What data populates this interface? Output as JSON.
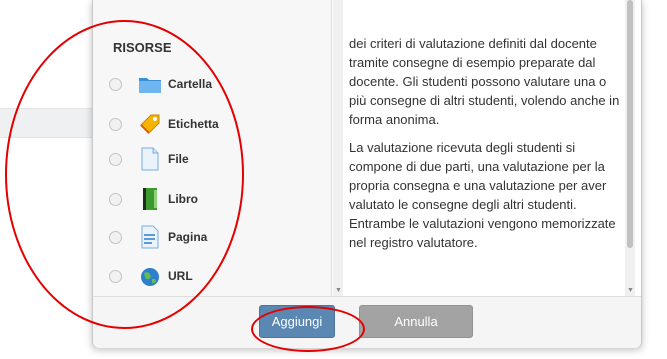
{
  "modal": {
    "section_title": "RISORSE",
    "resources": [
      {
        "label": "Cartella",
        "icon": "folder-icon"
      },
      {
        "label": "Etichetta",
        "icon": "label-tag-icon"
      },
      {
        "label": "File",
        "icon": "file-icon"
      },
      {
        "label": "Libro",
        "icon": "book-icon"
      },
      {
        "label": "Pagina",
        "icon": "page-icon"
      },
      {
        "label": "URL",
        "icon": "url-globe-icon"
      }
    ],
    "description": [
      "dei criteri di valutazione definiti dal docente tramite consegne di esempio preparate dal docente. Gli studenti possono valutare una o più consegne di altri studenti, volendo anche in forma anonima.",
      "La valutazione ricevuta degli studenti si compone di due parti, una valutazione per la propria consegna e una valutazione per aver valutato le consegne degli altri studenti. Entrambe le valutazioni vengono memorizzate nel registro valutatore."
    ],
    "buttons": {
      "add": "Aggiungi",
      "cancel": "Annulla"
    }
  },
  "colors": {
    "primary_button": "#5b87b3",
    "secondary_button": "#a3a3a3",
    "annotation": "#e40000"
  }
}
